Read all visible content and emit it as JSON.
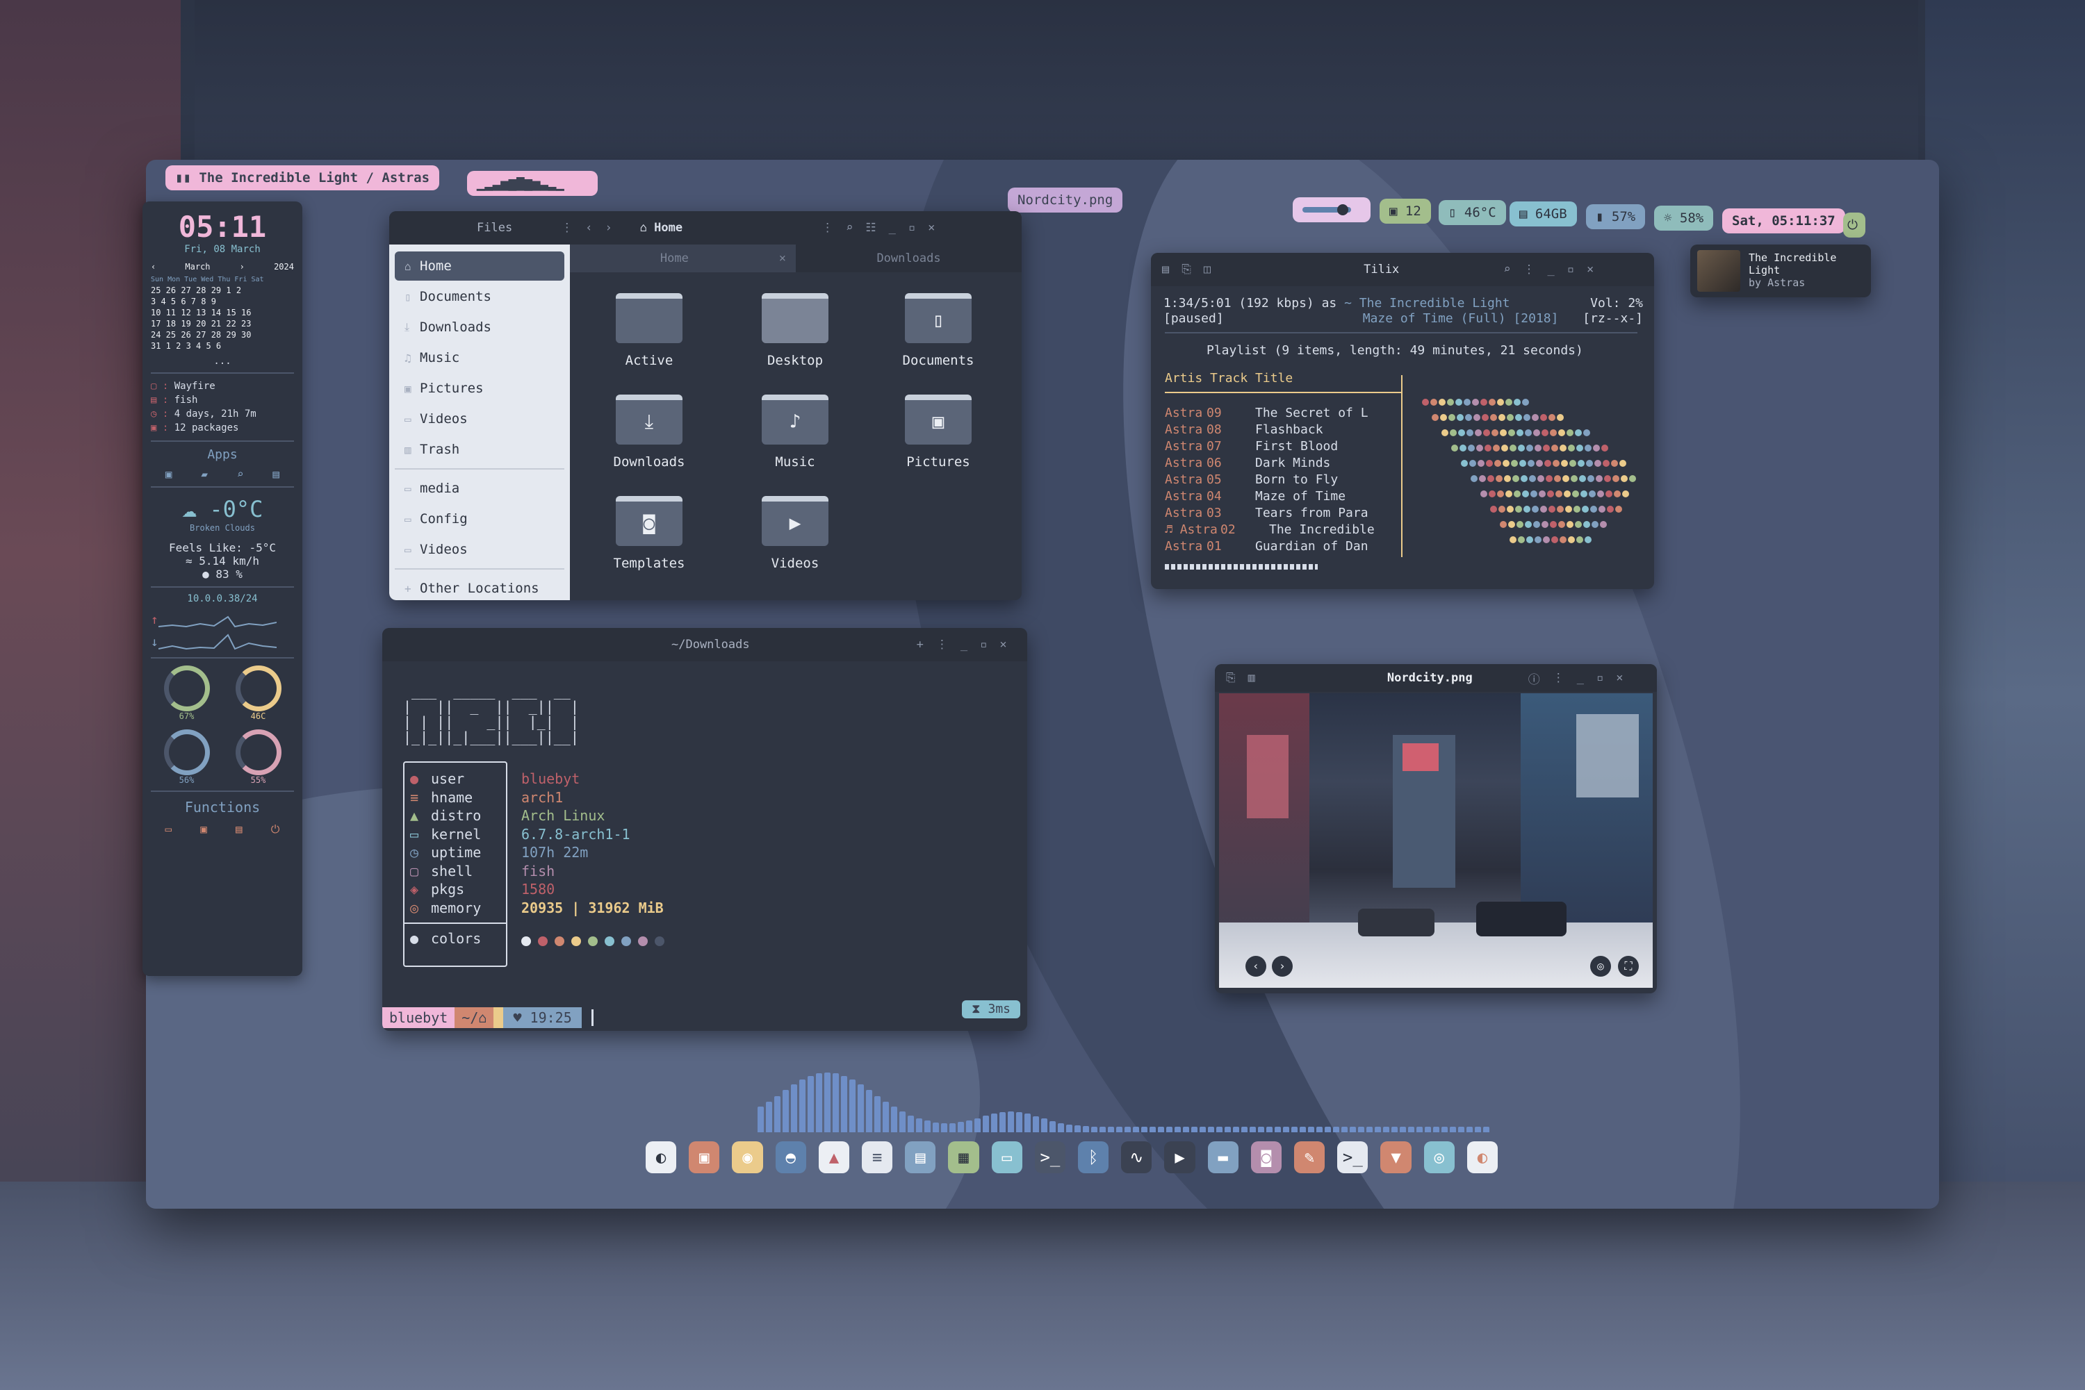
{
  "topbar": {
    "title": "The Incredible Light / Astras",
    "visualizer": "▁▂▃▅▆▇▆▅▃▂▁",
    "center_label": "Nordcity.png",
    "gpu_count": "12",
    "temp": "46°C",
    "disk": "64GB",
    "battery": "57%",
    "brightness": "58%",
    "clock": "Sat, 05:11:37"
  },
  "nowplaying": {
    "title": "The Incredible",
    "title2": "Light",
    "artist": "by Astras"
  },
  "sidebar": {
    "time": "05:11",
    "date": "Fri, 08 March",
    "cal_month": "March",
    "cal_year": "2024",
    "cal_days": "Sun Mon Tue Wed Thu Fri Sat",
    "cal_rows": [
      "25 26 27 28 29  1  2",
      "3  4  5  6  7  8  9",
      "10 11 12 13 14 15 16",
      "17 18 19 20 21 22 23",
      "24 25 26 27 28 29 30",
      "31  1  2  3  4  5  6"
    ],
    "ellipsis": "...",
    "info": [
      "Wayfire",
      "fish",
      "4 days, 21h 7m",
      "12 packages"
    ],
    "apps_title": "Apps",
    "weather_temp": "-0°C",
    "weather_desc": "Broken Clouds",
    "feels_like": "Feels Like: -5°C",
    "wind": "5.14 km/h",
    "humidity": "83 %",
    "ip": "10.0.0.38/24",
    "gauges": [
      "67%",
      "46C",
      "56%",
      "55%"
    ],
    "functions_title": "Functions"
  },
  "files": {
    "sidebar_title": "Files",
    "path": "Home",
    "tabs": [
      "Home",
      "Downloads"
    ],
    "sidebar_items": [
      "Home",
      "Documents",
      "Downloads",
      "Music",
      "Pictures",
      "Videos",
      "Trash",
      "media",
      "Config",
      "Videos",
      "Other Locations"
    ],
    "folders": [
      "Active",
      "Desktop",
      "Documents",
      "Downloads",
      "Music",
      "Pictures",
      "Templates",
      "Videos"
    ]
  },
  "terminal": {
    "title": "~/Downloads",
    "labels": [
      "user",
      "hname",
      "distro",
      "kernel",
      "uptime",
      "shell",
      "pkgs",
      "memory"
    ],
    "values": [
      "bluebyt",
      "arch1",
      "Arch Linux",
      "6.7.8-arch1-1",
      "107h 22m",
      "fish",
      "1580",
      "20935 | 31962 MiB"
    ],
    "colors_label": "colors",
    "prompt_user": "bluebyt",
    "prompt_dir": "~/",
    "prompt_time": "19:25",
    "duration": "3ms",
    "swatches": [
      "#e5e9f0",
      "#bf616a",
      "#d08770",
      "#ebcb8b",
      "#a3be8c",
      "#88c0d0",
      "#81a1c1",
      "#b48ead",
      "#4c566a"
    ]
  },
  "tilix": {
    "title": "Tilix",
    "status_line": "1:34/5:01 (192 kbps) as",
    "now_title": "~ The Incredible Light",
    "now_album": "Maze of Time (Full) [2018]",
    "paused": "[paused]",
    "vol": "Vol: 2%",
    "flags": "[rz--x-]",
    "playlist_header": "Playlist (9 items, length: 49 minutes, 21 seconds)",
    "columns": "Artis Track Title",
    "rows": [
      [
        "Astra",
        "09",
        "The Secret of L"
      ],
      [
        "Astra",
        "08",
        "Flashback"
      ],
      [
        "Astra",
        "07",
        "First Blood"
      ],
      [
        "Astra",
        "06",
        "Dark Minds"
      ],
      [
        "Astra",
        "05",
        "Born to Fly"
      ],
      [
        "Astra",
        "04",
        "Maze of Time"
      ],
      [
        "Astra",
        "03",
        "Tears from Para"
      ],
      [
        "Astra",
        "02",
        "The Incredible"
      ],
      [
        "Astra",
        "01",
        "Guardian of Dan"
      ]
    ]
  },
  "viewer": {
    "title": "Nordcity.png"
  }
}
